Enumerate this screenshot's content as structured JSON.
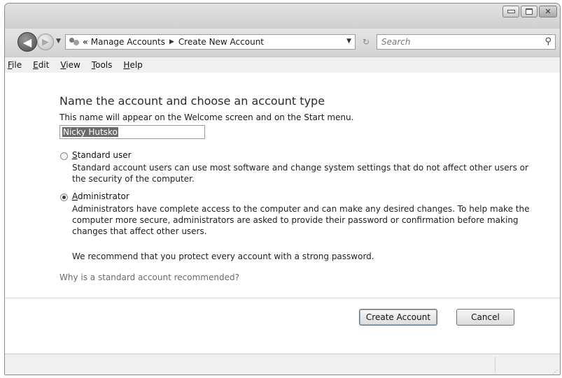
{
  "window": {
    "caption_buttons": {
      "minimize_icon": "minimize-icon",
      "maximize_icon": "maximize-icon",
      "close_glyph": "✕"
    }
  },
  "navbar": {
    "breadcrumb_sep": "«",
    "breadcrumb": [
      "Manage Accounts",
      "Create New Account"
    ],
    "breadcrumb_arrow": "▶",
    "dropdown_glyph": "▼",
    "refresh_glyph": "↻",
    "search_placeholder": "Search",
    "search_glyph": "⚲"
  },
  "menu": [
    {
      "label_u": "F",
      "label_rest": "ile"
    },
    {
      "label_u": "E",
      "label_rest": "dit"
    },
    {
      "label_u": "V",
      "label_rest": "iew"
    },
    {
      "label_u": "T",
      "label_rest": "ools"
    },
    {
      "label_u": "H",
      "label_rest": "elp"
    }
  ],
  "form": {
    "heading": "Name the account and choose an account type",
    "description": "This name will appear on the Welcome screen and on the Start menu.",
    "name_value": "Nicky Hutsko",
    "standard": {
      "label_u": "S",
      "label_rest": "tandard user",
      "checked": false,
      "text": "Standard account users can use most software and change system settings that do not affect other users or the security of the computer."
    },
    "administrator": {
      "label_u": "A",
      "label_rest": "dministrator",
      "checked": true,
      "text": "Administrators have complete access to the computer and can make any desired changes. To help make the computer more secure, administrators are asked to provide their password or confirmation before making changes that affect other users."
    },
    "recommendation": "We recommend that you protect every account with a strong password.",
    "help_link": "Why is a standard account recommended?",
    "create_button": "Create Account",
    "cancel_button": "Cancel"
  },
  "colors": {
    "chrome": "#d4d4d4",
    "link": "#6a6a6a"
  }
}
